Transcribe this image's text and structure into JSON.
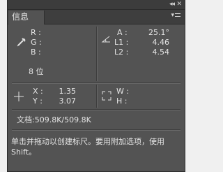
{
  "panel": {
    "tab_label": "信息",
    "collapse_glyph": "◂◂",
    "close_glyph": "✕",
    "menu_glyph": "▾"
  },
  "color_readout": {
    "labels": [
      "R :",
      "G :",
      "B :"
    ],
    "bit_depth": "8 位"
  },
  "angle_readout": {
    "rows": [
      {
        "label": "A :",
        "value": "25.1°"
      },
      {
        "label": "L1 :",
        "value": "4.46"
      },
      {
        "label": "L2 :",
        "value": "4.54"
      }
    ]
  },
  "position_readout": {
    "rows": [
      {
        "label": "X :",
        "value": "1.35"
      },
      {
        "label": "Y :",
        "value": "3.07"
      }
    ]
  },
  "size_readout": {
    "labels": [
      "W :",
      "H :"
    ]
  },
  "document": {
    "label": "文档:509.8K/509.8K"
  },
  "hint": {
    "text": "单击并拖动以创建标尺。要用附加选项，使用 Shift。"
  },
  "colors": {
    "panel_bg": "#535353",
    "text": "#e4e4e4",
    "tabbar_bg": "#3e3e3e"
  }
}
